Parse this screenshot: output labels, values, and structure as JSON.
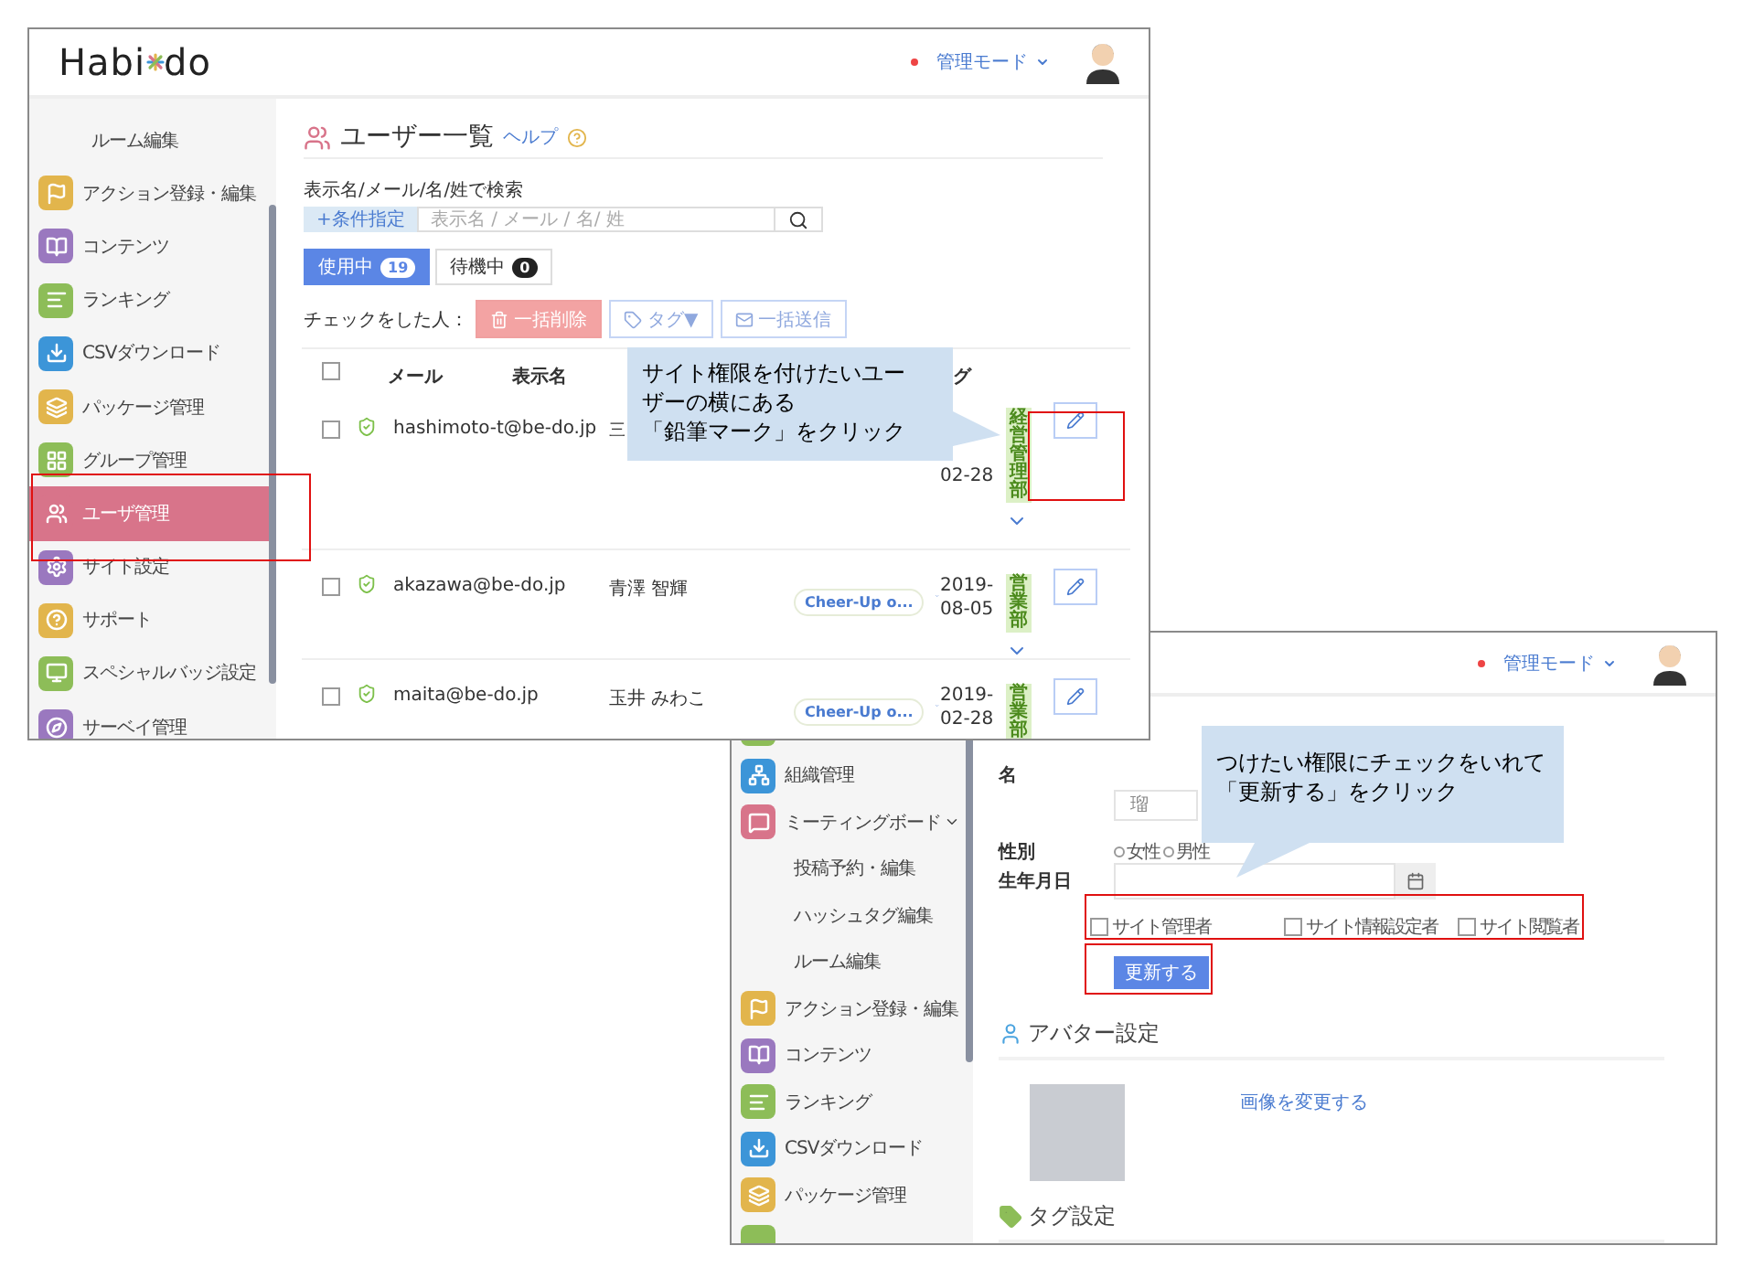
{
  "window_1": {
    "logo": {
      "before": "Habi",
      "after": "do"
    },
    "mode_menu": "管理モード",
    "sidebar": [
      {
        "label": "ルーム編集",
        "kind": "sub",
        "selected": false
      },
      {
        "label": "アクション登録・編集",
        "kind": "icon",
        "color": "#e2b54c",
        "selected": false
      },
      {
        "label": "コンテンツ",
        "kind": "icon",
        "color": "#9a78bf",
        "selected": false
      },
      {
        "label": "ランキング",
        "kind": "icon",
        "color": "#8dbd58",
        "selected": false
      },
      {
        "label": "CSVダウンロード",
        "kind": "icon",
        "color": "#3c95d8",
        "selected": false
      },
      {
        "label": "パッケージ管理",
        "kind": "icon",
        "color": "#e2b54c",
        "selected": false
      },
      {
        "label": "グループ管理",
        "kind": "icon",
        "color": "#8dbd58",
        "selected": false
      },
      {
        "label": "ユーザ管理",
        "kind": "icon",
        "color": "#d8748a",
        "selected": true
      },
      {
        "label": "サイト設定",
        "kind": "icon",
        "color": "#9a78bf",
        "selected": false
      },
      {
        "label": "サポート",
        "kind": "icon",
        "color": "#e2b54c",
        "selected": false
      },
      {
        "label": "スペシャルバッジ設定",
        "kind": "icon",
        "color": "#8dbd58",
        "selected": false
      },
      {
        "label": "サーベイ管理",
        "kind": "icon",
        "color": "#9a78bf",
        "selected": false
      }
    ],
    "page_title": "ユーザー一覧",
    "help_link": "ヘルプ",
    "search": {
      "label": "表示名/メール/名/姓で検索",
      "filter_button": "+条件指定",
      "placeholder": "表示名 / メール / 名/ 姓"
    },
    "status_tabs": [
      {
        "label": "使用中",
        "count": "19",
        "selected": true
      },
      {
        "label": "待機中",
        "count": "0",
        "selected": false
      }
    ],
    "bulk_actions": {
      "label": "チェックをした人：",
      "buttons": [
        {
          "label": "一括削除",
          "kind": "delete"
        },
        {
          "label": "タグ▼",
          "kind": "tag"
        },
        {
          "label": "一括送信",
          "kind": "mail"
        }
      ]
    },
    "table": {
      "select_all_checked": false,
      "columns": [
        "メール",
        "表示名",
        "グ"
      ],
      "rows": [
        {
          "checked": false,
          "email": "hashimoto-t@be-do.jp",
          "name": "三",
          "date": "02-28",
          "tag": "経営管理部",
          "more": true
        },
        {
          "checked": false,
          "email": "akazawa@be-do.jp",
          "name": "青澤 智輝",
          "badge": "Cheer-Up o...",
          "date": "2019-08-05",
          "tag": "営業部",
          "more": true
        },
        {
          "checked": false,
          "email": "maita@be-do.jp",
          "name": "玉井 みわこ",
          "badge": "Cheer-Up o...",
          "date": "2019-02-28",
          "tag": "営業部",
          "more": false
        }
      ]
    }
  },
  "window_2": {
    "mode_menu": "管理モード",
    "sidebar": [
      {
        "kind": "partial",
        "color": "#8dbd58",
        "selected": false
      },
      {
        "label": "組織管理",
        "kind": "icon",
        "color": "#3c95d8",
        "selected": false
      },
      {
        "label": "ミーティングボード",
        "kind": "icon",
        "color": "#d8748a",
        "selected": false,
        "expanded": true
      },
      {
        "label": "投稿予約・編集",
        "kind": "sub",
        "selected": false
      },
      {
        "label": "ハッシュタグ編集",
        "kind": "sub",
        "selected": false
      },
      {
        "label": "ルーム編集",
        "kind": "sub",
        "selected": false
      },
      {
        "label": "アクション登録・編集",
        "kind": "icon",
        "color": "#e2b54c",
        "selected": false
      },
      {
        "label": "コンテンツ",
        "kind": "icon",
        "color": "#9a78bf",
        "selected": false
      },
      {
        "label": "ランキング",
        "kind": "icon",
        "color": "#8dbd58",
        "selected": false
      },
      {
        "label": "CSVダウンロード",
        "kind": "icon",
        "color": "#3c95d8",
        "selected": false
      },
      {
        "label": "パッケージ管理",
        "kind": "icon",
        "color": "#e2b54c",
        "selected": false
      },
      {
        "kind": "partial",
        "color": "#8dbd58",
        "selected": false
      }
    ],
    "form": {
      "name_label": "名",
      "name_value": "瑠",
      "gender": {
        "label": "性別",
        "options": [
          {
            "label": "女性",
            "selected": false
          },
          {
            "label": "男性",
            "selected": false
          }
        ]
      },
      "birthdate_label": "生年月日",
      "roles": [
        {
          "label": "サイト管理者",
          "checked": false
        },
        {
          "label": "サイト情報設定者",
          "checked": false
        },
        {
          "label": "サイト閲覧者",
          "checked": false
        }
      ],
      "submit": "更新する"
    },
    "avatar_section": {
      "title": "アバター設定",
      "change_link": "画像を変更する"
    },
    "tag_section": {
      "title": "タグ設定"
    }
  },
  "callouts": [
    {
      "lines": [
        "サイト権限を付けたいユー",
        "ザーの横にある",
        "「鉛筆マーク」をクリック"
      ]
    },
    {
      "lines": [
        "つけたい権限にチェックをいれて",
        "「更新する」をクリック"
      ]
    }
  ]
}
